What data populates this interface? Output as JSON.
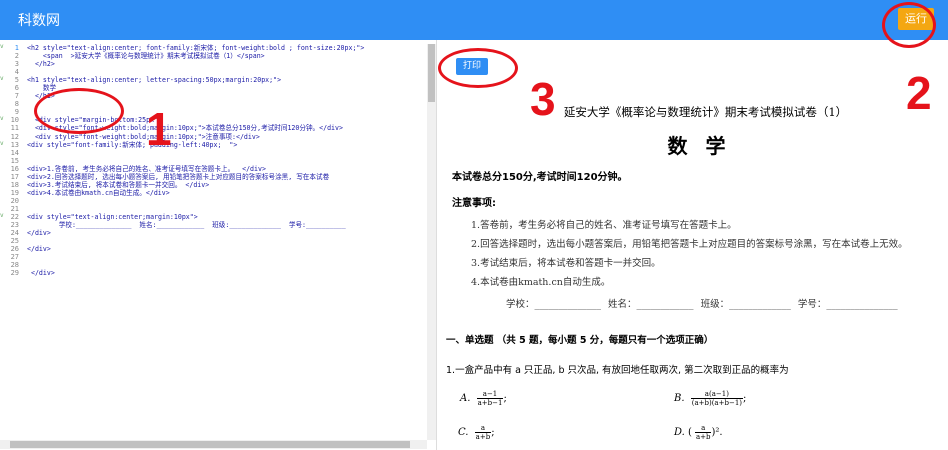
{
  "header": {
    "brand": "科数网",
    "run_label": "运行"
  },
  "editor": {
    "line_numbers": [
      "1",
      "2",
      "3",
      "4",
      "5",
      "6",
      "7",
      "8",
      "9",
      "10",
      "11",
      "12",
      "13",
      "14",
      "15",
      "16",
      "17",
      "18",
      "19",
      "20",
      "21",
      "22",
      "23",
      "24",
      "25",
      "26",
      "27",
      "28",
      "29"
    ],
    "lines": [
      "<h2 style=\"text-align:center; font-family:新宋体; font-weight:bold ; font-size:20px;\">",
      "    <span  >延安大学《概率论与数理统计》期末考试模拟试卷（1）</span>",
      "  </h2>",
      "",
      "<h1 style=\"text-align:center; letter-spacing:50px;margin:20px;\">",
      "    数学",
      "  </h1>",
      "",
      "",
      "  <div style=\"margin-bottom:25px\">",
      "  <div style=\"font-weight:bold;margin:10px;\">本试卷总分150分,考试时间120分钟。</div>",
      "  <div style=\"font-weight:bold;margin:10px;\">注意事项:</div>",
      "<div style=\"font-family:新宋体; padding-left:40px;  \">",
      "",
      "",
      "<div>1.答卷前, 考生务必将自己的姓名、准考证号填写在答题卡上。  </div>",
      "<div>2.回答选择题时, 选出每小题答案后, 用铅笔把答题卡上对应题目的答案标号涂黑, 写在本试卷",
      "<div>3.考试结束后, 将本试卷和答题卡一并交回。 </div>",
      "<div>4.本试卷由kmath.cn自动生成。</div>",
      "",
      "",
      "<div style=\"text-align:center;margin:10px\">",
      "        学校:______________  姓名:____________  班级:_____________  学号:__________",
      "</div>",
      "",
      "</div>",
      "",
      "",
      " </div>"
    ]
  },
  "preview": {
    "print_label": "打印",
    "title": "延安大学《概率论与数理统计》期末考试模拟试卷（1）",
    "subject": "数学",
    "total": "本试卷总分150分,考试时间120分钟。",
    "notice": "注意事项:",
    "rules": [
      "1.答卷前，考生务必将自己的姓名、准考证号填写在答题卡上。",
      "2.回答选择题时，选出每小题答案后，用铅笔把答题卡上对应题目的答案标号涂黑，写在本试卷上无效。",
      "3.考试结束后，将本试卷和答题卡一并交回。",
      "4.本试卷由kmath.cn自动生成。"
    ],
    "fields": {
      "school": "学校：______________",
      "name": "姓名：____________",
      "class": "班级：_____________",
      "number": "学号：_______________"
    },
    "section": "一、单选题 （共 5 题，每小题 5 分，每题只有一个选项正确）",
    "question1": "1.一盒产品中有 a 只正品, b 只次品, 有放回地任取两次, 第二次取到正品的概率为",
    "options": {
      "A": {
        "label": "A.",
        "num": "a−1",
        "den": "a+b−1",
        "tail": ";"
      },
      "B": {
        "label": "B.",
        "num": "a(a−1)",
        "den": "(a+b)(a+b−1)",
        "tail": ";"
      },
      "C": {
        "label": "C.",
        "num": "a",
        "den": "a+b",
        "tail": ";"
      },
      "D": {
        "label": "D.",
        "num": "a",
        "den": "a+b",
        "tail": ")².",
        "lead": "("
      }
    }
  },
  "annotations": {
    "n1": "1",
    "n2": "2",
    "n3": "3",
    "color": "#e5131b"
  }
}
